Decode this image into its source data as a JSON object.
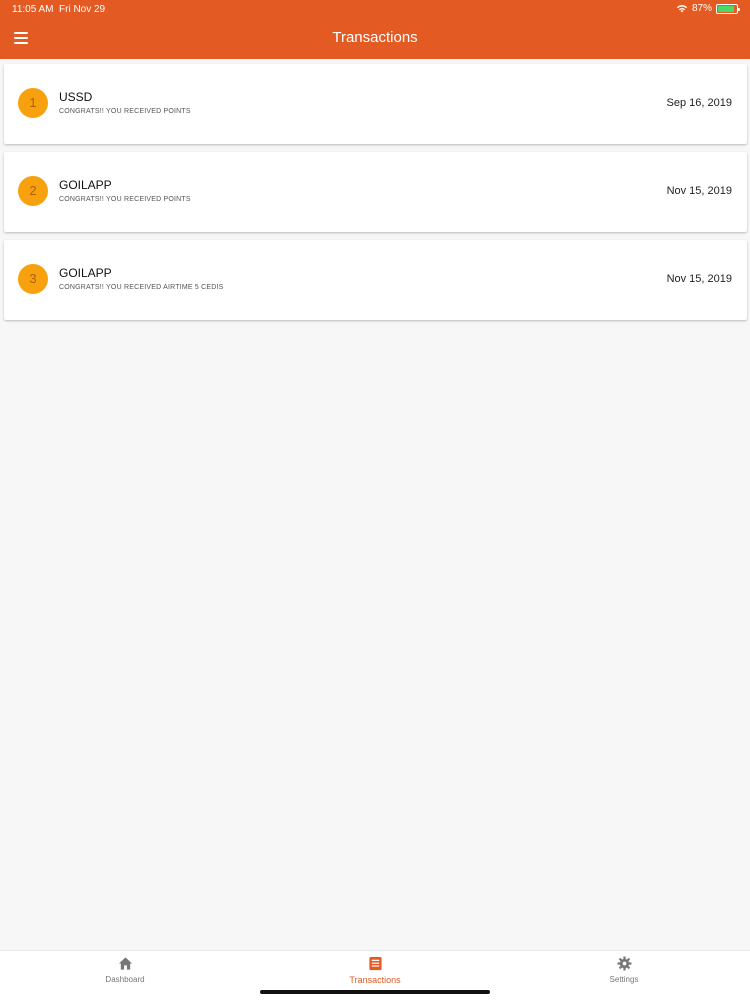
{
  "status_bar": {
    "time": "11:05 AM",
    "date": "Fri Nov 29",
    "battery": "87%",
    "battery_level": 0.87
  },
  "header": {
    "title": "Transactions"
  },
  "transactions": [
    {
      "index": "1",
      "title": "USSD",
      "message": "CONGRATS!! YOU RECEIVED POINTS",
      "date": "Sep 16, 2019"
    },
    {
      "index": "2",
      "title": "GOILAPP",
      "message": "CONGRATS!! YOU RECEIVED POINTS",
      "date": "Nov 15, 2019"
    },
    {
      "index": "3",
      "title": "GOILAPP",
      "message": "CONGRATS!! YOU RECEIVED AIRTIME 5 CEDIS",
      "date": "Nov 15, 2019"
    }
  ],
  "tabs": [
    {
      "label": "Dashboard",
      "icon": "home-icon"
    },
    {
      "label": "Transactions",
      "icon": "list-icon",
      "active": true
    },
    {
      "label": "Settings",
      "icon": "gear-icon"
    }
  ],
  "colors": {
    "accent": "#e45a23",
    "badge": "#f7a10e"
  }
}
